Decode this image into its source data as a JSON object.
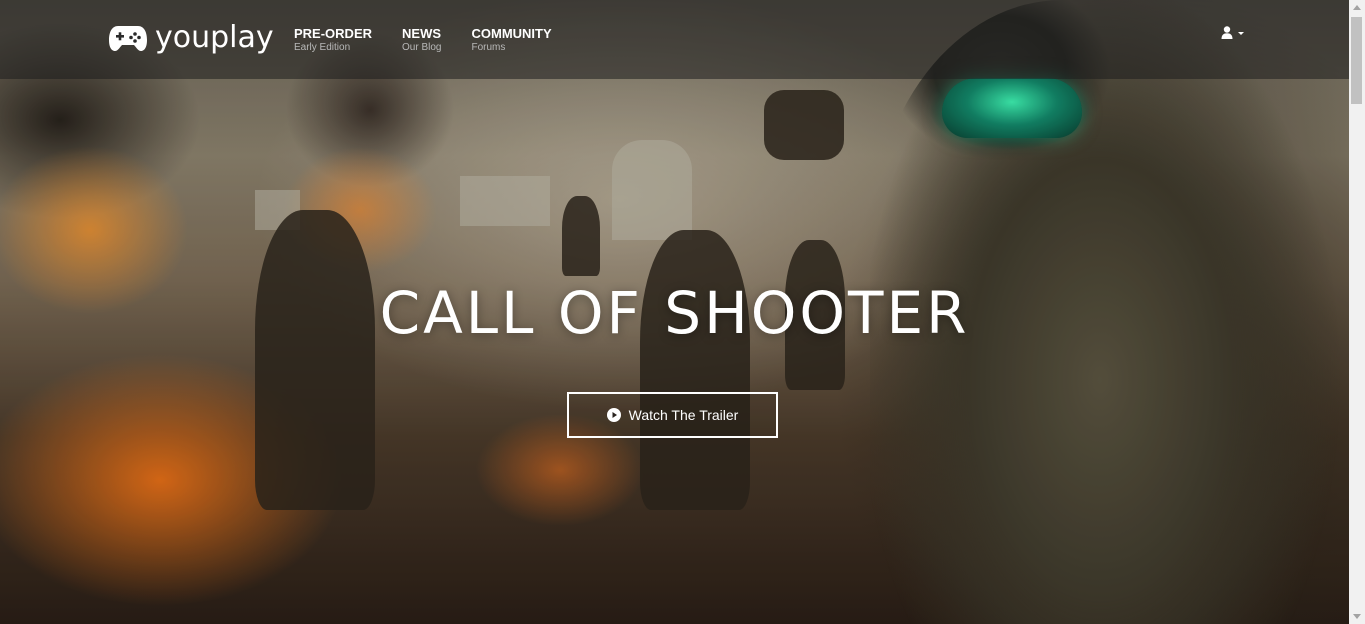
{
  "brand": {
    "name": "youplay",
    "icon": "gamepad-icon"
  },
  "nav": {
    "items": [
      {
        "label": "PRE-ORDER",
        "sub": "Early Edition"
      },
      {
        "label": "NEWS",
        "sub": "Our Blog"
      },
      {
        "label": "COMMUNITY",
        "sub": "Forums"
      }
    ]
  },
  "user_menu": {
    "icon": "user-icon",
    "caret": "caret-down-icon"
  },
  "hero": {
    "title": "CALL OF SHOOTER",
    "trailer_button": {
      "label": "Watch The Trailer",
      "icon": "play-circle-icon"
    }
  },
  "colors": {
    "navbar_bg": "rgba(30,30,30,0.55)",
    "text": "#ffffff",
    "sub_text": "#b8b8b8",
    "goggle_accent": "#2ed79a"
  }
}
